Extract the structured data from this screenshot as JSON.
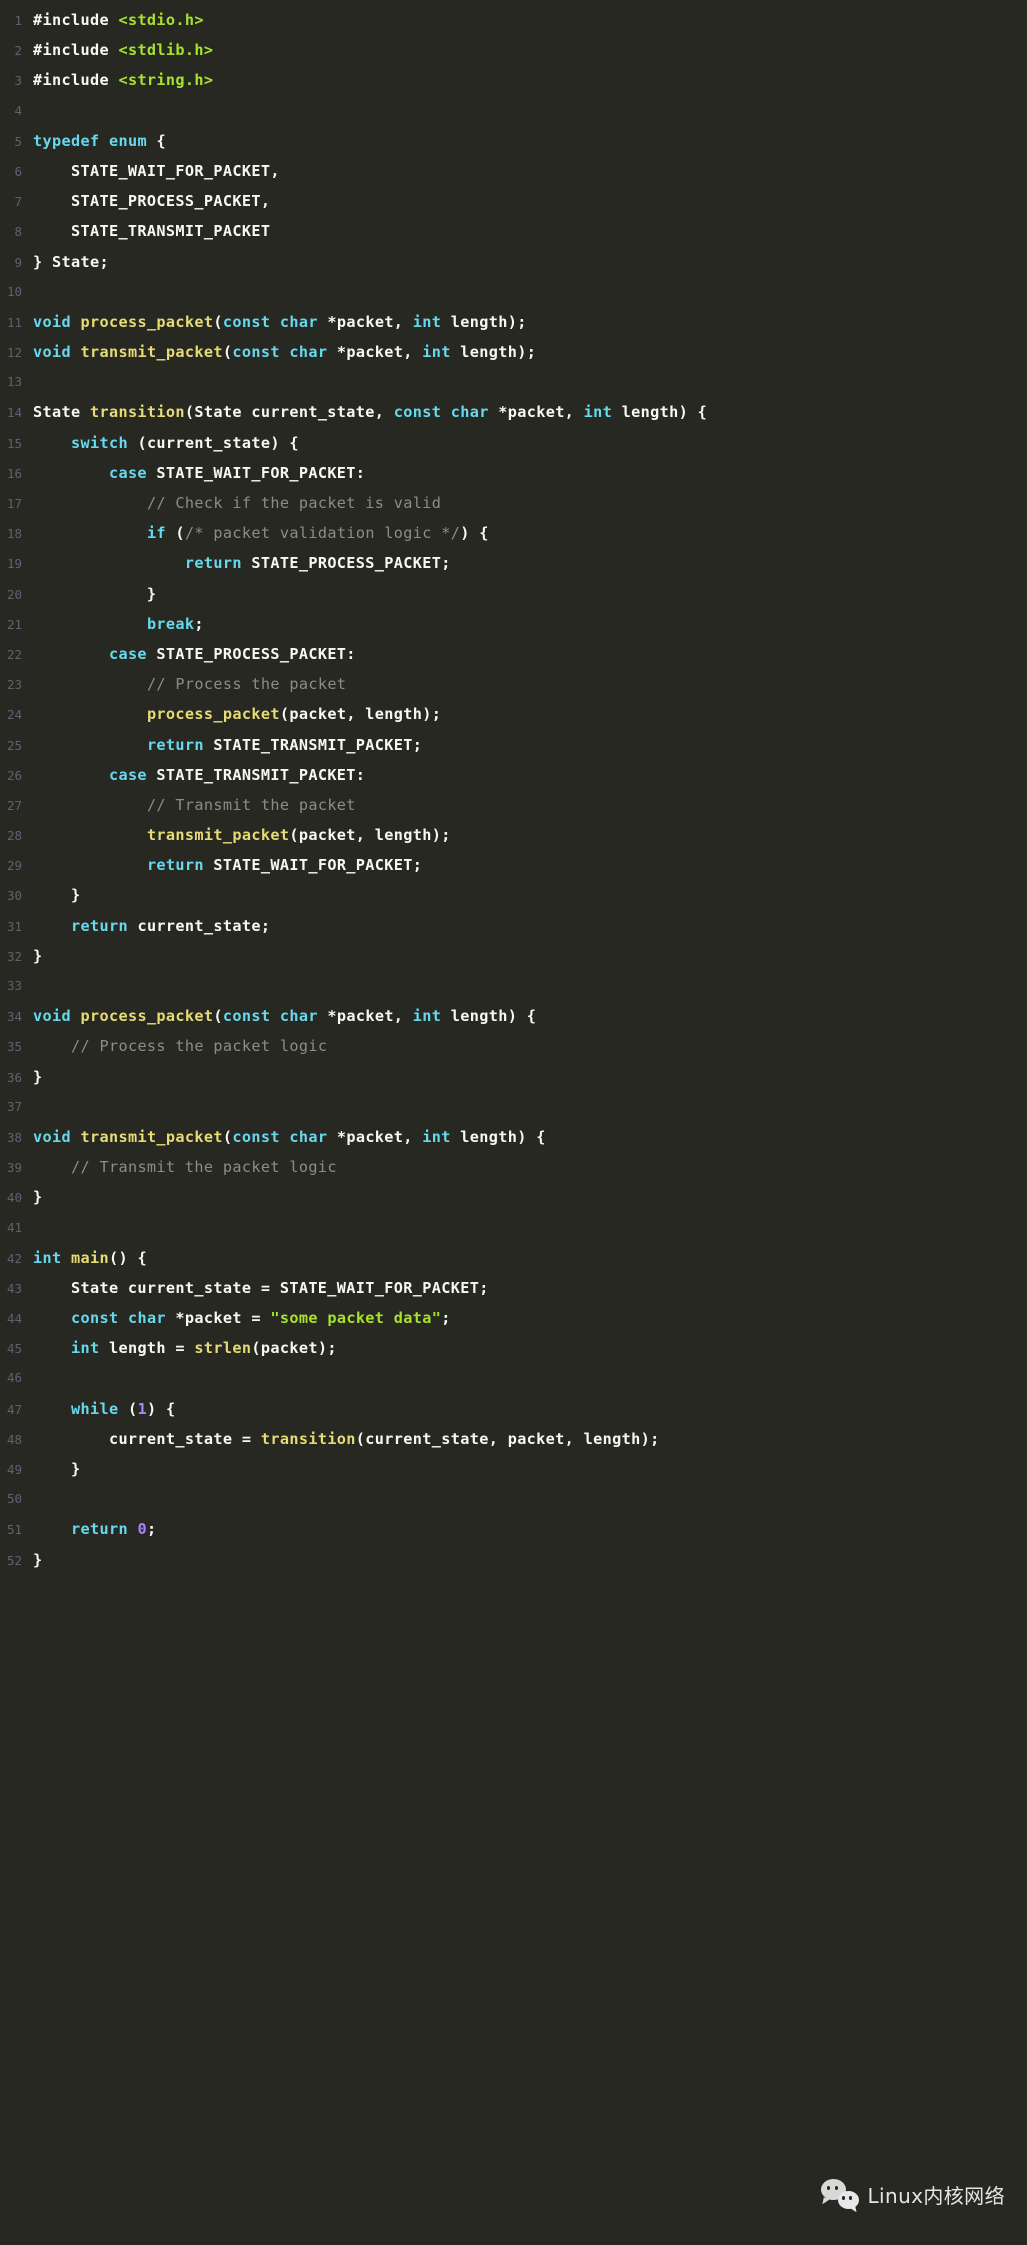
{
  "editor": {
    "language": "c",
    "theme": "monokai-dark",
    "background": "#272822",
    "colors": {
      "text": "#f8f8f2",
      "keyword": "#66d9ef",
      "function": "#e6db74",
      "string": "#a6e22e",
      "comment": "#888e88",
      "number": "#ae81ff",
      "line_number": "#5c6370"
    },
    "first_line_number": 1,
    "last_line_number": 52,
    "lines": [
      {
        "n": 1,
        "tokens": [
          {
            "t": "#include ",
            "c": "pl"
          },
          {
            "t": "<stdio.h>",
            "c": "str"
          }
        ]
      },
      {
        "n": 2,
        "tokens": [
          {
            "t": "#include ",
            "c": "pl"
          },
          {
            "t": "<stdlib.h>",
            "c": "str"
          }
        ]
      },
      {
        "n": 3,
        "tokens": [
          {
            "t": "#include ",
            "c": "pl"
          },
          {
            "t": "<string.h>",
            "c": "str"
          }
        ]
      },
      {
        "n": 4,
        "tokens": []
      },
      {
        "n": 5,
        "tokens": [
          {
            "t": "typedef",
            "c": "kw"
          },
          {
            "t": " ",
            "c": "pl"
          },
          {
            "t": "enum",
            "c": "kw"
          },
          {
            "t": " {",
            "c": "pl"
          }
        ]
      },
      {
        "n": 6,
        "tokens": [
          {
            "t": "    STATE_WAIT_FOR_PACKET,",
            "c": "pl"
          }
        ]
      },
      {
        "n": 7,
        "tokens": [
          {
            "t": "    STATE_PROCESS_PACKET,",
            "c": "pl"
          }
        ]
      },
      {
        "n": 8,
        "tokens": [
          {
            "t": "    STATE_TRANSMIT_PACKET",
            "c": "pl"
          }
        ]
      },
      {
        "n": 9,
        "tokens": [
          {
            "t": "} State;",
            "c": "pl"
          }
        ]
      },
      {
        "n": 10,
        "tokens": []
      },
      {
        "n": 11,
        "tokens": [
          {
            "t": "void",
            "c": "kw"
          },
          {
            "t": " ",
            "c": "pl"
          },
          {
            "t": "process_packet",
            "c": "fn"
          },
          {
            "t": "(",
            "c": "pl"
          },
          {
            "t": "const",
            "c": "kw"
          },
          {
            "t": " ",
            "c": "pl"
          },
          {
            "t": "char",
            "c": "kw"
          },
          {
            "t": " *packet, ",
            "c": "pl"
          },
          {
            "t": "int",
            "c": "kw"
          },
          {
            "t": " length);",
            "c": "pl"
          }
        ]
      },
      {
        "n": 12,
        "tokens": [
          {
            "t": "void",
            "c": "kw"
          },
          {
            "t": " ",
            "c": "pl"
          },
          {
            "t": "transmit_packet",
            "c": "fn"
          },
          {
            "t": "(",
            "c": "pl"
          },
          {
            "t": "const",
            "c": "kw"
          },
          {
            "t": " ",
            "c": "pl"
          },
          {
            "t": "char",
            "c": "kw"
          },
          {
            "t": " *packet, ",
            "c": "pl"
          },
          {
            "t": "int",
            "c": "kw"
          },
          {
            "t": " length);",
            "c": "pl"
          }
        ]
      },
      {
        "n": 13,
        "tokens": []
      },
      {
        "n": 14,
        "tokens": [
          {
            "t": "State ",
            "c": "pl"
          },
          {
            "t": "transition",
            "c": "fn"
          },
          {
            "t": "(State current_state, ",
            "c": "pl"
          },
          {
            "t": "const",
            "c": "kw"
          },
          {
            "t": " ",
            "c": "pl"
          },
          {
            "t": "char",
            "c": "kw"
          },
          {
            "t": " *packet, ",
            "c": "pl"
          },
          {
            "t": "int",
            "c": "kw"
          },
          {
            "t": " length) {",
            "c": "pl"
          }
        ]
      },
      {
        "n": 15,
        "tokens": [
          {
            "t": "    ",
            "c": "pl"
          },
          {
            "t": "switch",
            "c": "kw"
          },
          {
            "t": " (current_state) {",
            "c": "pl"
          }
        ]
      },
      {
        "n": 16,
        "tokens": [
          {
            "t": "        ",
            "c": "pl"
          },
          {
            "t": "case",
            "c": "kw"
          },
          {
            "t": " STATE_WAIT_FOR_PACKET:",
            "c": "pl"
          }
        ]
      },
      {
        "n": 17,
        "tokens": [
          {
            "t": "            ",
            "c": "pl"
          },
          {
            "t": "// Check if the packet is valid",
            "c": "cmt"
          }
        ]
      },
      {
        "n": 18,
        "tokens": [
          {
            "t": "            ",
            "c": "pl"
          },
          {
            "t": "if",
            "c": "kw"
          },
          {
            "t": " (",
            "c": "pl"
          },
          {
            "t": "/* packet validation logic */",
            "c": "cmt"
          },
          {
            "t": ") {",
            "c": "pl"
          }
        ]
      },
      {
        "n": 19,
        "tokens": [
          {
            "t": "                ",
            "c": "pl"
          },
          {
            "t": "return",
            "c": "kw"
          },
          {
            "t": " STATE_PROCESS_PACKET;",
            "c": "pl"
          }
        ]
      },
      {
        "n": 20,
        "tokens": [
          {
            "t": "            }",
            "c": "pl"
          }
        ]
      },
      {
        "n": 21,
        "tokens": [
          {
            "t": "            ",
            "c": "pl"
          },
          {
            "t": "break",
            "c": "kw"
          },
          {
            "t": ";",
            "c": "pl"
          }
        ]
      },
      {
        "n": 22,
        "tokens": [
          {
            "t": "        ",
            "c": "pl"
          },
          {
            "t": "case",
            "c": "kw"
          },
          {
            "t": " STATE_PROCESS_PACKET:",
            "c": "pl"
          }
        ]
      },
      {
        "n": 23,
        "tokens": [
          {
            "t": "            ",
            "c": "pl"
          },
          {
            "t": "// Process the packet",
            "c": "cmt"
          }
        ]
      },
      {
        "n": 24,
        "tokens": [
          {
            "t": "            ",
            "c": "pl"
          },
          {
            "t": "process_packet",
            "c": "fn"
          },
          {
            "t": "(packet, length);",
            "c": "pl"
          }
        ]
      },
      {
        "n": 25,
        "tokens": [
          {
            "t": "            ",
            "c": "pl"
          },
          {
            "t": "return",
            "c": "kw"
          },
          {
            "t": " STATE_TRANSMIT_PACKET;",
            "c": "pl"
          }
        ]
      },
      {
        "n": 26,
        "tokens": [
          {
            "t": "        ",
            "c": "pl"
          },
          {
            "t": "case",
            "c": "kw"
          },
          {
            "t": " STATE_TRANSMIT_PACKET:",
            "c": "pl"
          }
        ]
      },
      {
        "n": 27,
        "tokens": [
          {
            "t": "            ",
            "c": "pl"
          },
          {
            "t": "// Transmit the packet",
            "c": "cmt"
          }
        ]
      },
      {
        "n": 28,
        "tokens": [
          {
            "t": "            ",
            "c": "pl"
          },
          {
            "t": "transmit_packet",
            "c": "fn"
          },
          {
            "t": "(packet, length);",
            "c": "pl"
          }
        ]
      },
      {
        "n": 29,
        "tokens": [
          {
            "t": "            ",
            "c": "pl"
          },
          {
            "t": "return",
            "c": "kw"
          },
          {
            "t": " STATE_WAIT_FOR_PACKET;",
            "c": "pl"
          }
        ]
      },
      {
        "n": 30,
        "tokens": [
          {
            "t": "    }",
            "c": "pl"
          }
        ]
      },
      {
        "n": 31,
        "tokens": [
          {
            "t": "    ",
            "c": "pl"
          },
          {
            "t": "return",
            "c": "kw"
          },
          {
            "t": " current_state;",
            "c": "pl"
          }
        ]
      },
      {
        "n": 32,
        "tokens": [
          {
            "t": "}",
            "c": "pl"
          }
        ]
      },
      {
        "n": 33,
        "tokens": []
      },
      {
        "n": 34,
        "tokens": [
          {
            "t": "void",
            "c": "kw"
          },
          {
            "t": " ",
            "c": "pl"
          },
          {
            "t": "process_packet",
            "c": "fn"
          },
          {
            "t": "(",
            "c": "pl"
          },
          {
            "t": "const",
            "c": "kw"
          },
          {
            "t": " ",
            "c": "pl"
          },
          {
            "t": "char",
            "c": "kw"
          },
          {
            "t": " *packet, ",
            "c": "pl"
          },
          {
            "t": "int",
            "c": "kw"
          },
          {
            "t": " length) {",
            "c": "pl"
          }
        ]
      },
      {
        "n": 35,
        "tokens": [
          {
            "t": "    ",
            "c": "pl"
          },
          {
            "t": "// Process the packet logic",
            "c": "cmt"
          }
        ]
      },
      {
        "n": 36,
        "tokens": [
          {
            "t": "}",
            "c": "pl"
          }
        ]
      },
      {
        "n": 37,
        "tokens": []
      },
      {
        "n": 38,
        "tokens": [
          {
            "t": "void",
            "c": "kw"
          },
          {
            "t": " ",
            "c": "pl"
          },
          {
            "t": "transmit_packet",
            "c": "fn"
          },
          {
            "t": "(",
            "c": "pl"
          },
          {
            "t": "const",
            "c": "kw"
          },
          {
            "t": " ",
            "c": "pl"
          },
          {
            "t": "char",
            "c": "kw"
          },
          {
            "t": " *packet, ",
            "c": "pl"
          },
          {
            "t": "int",
            "c": "kw"
          },
          {
            "t": " length) {",
            "c": "pl"
          }
        ]
      },
      {
        "n": 39,
        "tokens": [
          {
            "t": "    ",
            "c": "pl"
          },
          {
            "t": "// Transmit the packet logic",
            "c": "cmt"
          }
        ]
      },
      {
        "n": 40,
        "tokens": [
          {
            "t": "}",
            "c": "pl"
          }
        ]
      },
      {
        "n": 41,
        "tokens": []
      },
      {
        "n": 42,
        "tokens": [
          {
            "t": "int",
            "c": "kw"
          },
          {
            "t": " ",
            "c": "pl"
          },
          {
            "t": "main",
            "c": "fn"
          },
          {
            "t": "() {",
            "c": "pl"
          }
        ]
      },
      {
        "n": 43,
        "tokens": [
          {
            "t": "    State current_state = STATE_WAIT_FOR_PACKET;",
            "c": "pl"
          }
        ]
      },
      {
        "n": 44,
        "tokens": [
          {
            "t": "    ",
            "c": "pl"
          },
          {
            "t": "const",
            "c": "kw"
          },
          {
            "t": " ",
            "c": "pl"
          },
          {
            "t": "char",
            "c": "kw"
          },
          {
            "t": " *packet = ",
            "c": "pl"
          },
          {
            "t": "\"some packet data\"",
            "c": "str"
          },
          {
            "t": ";",
            "c": "pl"
          }
        ]
      },
      {
        "n": 45,
        "tokens": [
          {
            "t": "    ",
            "c": "pl"
          },
          {
            "t": "int",
            "c": "kw"
          },
          {
            "t": " length = ",
            "c": "pl"
          },
          {
            "t": "strlen",
            "c": "fn"
          },
          {
            "t": "(packet);",
            "c": "pl"
          }
        ]
      },
      {
        "n": 46,
        "tokens": []
      },
      {
        "n": 47,
        "tokens": [
          {
            "t": "    ",
            "c": "pl"
          },
          {
            "t": "while",
            "c": "kw"
          },
          {
            "t": " (",
            "c": "pl"
          },
          {
            "t": "1",
            "c": "num"
          },
          {
            "t": ") {",
            "c": "pl"
          }
        ]
      },
      {
        "n": 48,
        "tokens": [
          {
            "t": "        current_state = ",
            "c": "pl"
          },
          {
            "t": "transition",
            "c": "fn"
          },
          {
            "t": "(current_state, packet, length);",
            "c": "pl"
          }
        ]
      },
      {
        "n": 49,
        "tokens": [
          {
            "t": "    }",
            "c": "pl"
          }
        ]
      },
      {
        "n": 50,
        "tokens": []
      },
      {
        "n": 51,
        "tokens": [
          {
            "t": "    ",
            "c": "pl"
          },
          {
            "t": "return",
            "c": "kw"
          },
          {
            "t": " ",
            "c": "pl"
          },
          {
            "t": "0",
            "c": "num"
          },
          {
            "t": ";",
            "c": "pl"
          }
        ]
      },
      {
        "n": 52,
        "tokens": [
          {
            "t": "}",
            "c": "pl"
          }
        ]
      }
    ]
  },
  "watermark": {
    "icon": "wechat-icon",
    "label": "Linux内核网络"
  }
}
